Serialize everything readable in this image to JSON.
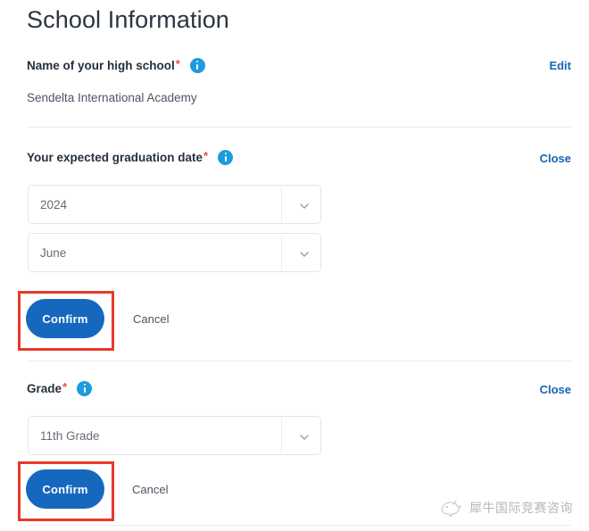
{
  "page": {
    "title": "School Information"
  },
  "sections": {
    "school_name": {
      "label": "Name of your high school",
      "required_marker": "*",
      "info_icon": "info-circle-icon",
      "action_label": "Edit",
      "value": "Sendelta International Academy"
    },
    "graduation_date": {
      "label": "Your expected graduation date",
      "required_marker": "*",
      "info_icon": "info-circle-icon",
      "action_label": "Close",
      "year_value": "2024",
      "month_value": "June",
      "chevron_icon": "chevron-down-icon",
      "confirm_label": "Confirm",
      "cancel_label": "Cancel"
    },
    "grade": {
      "label": "Grade",
      "required_marker": "*",
      "info_icon": "info-circle-icon",
      "action_label": "Close",
      "grade_value": "11th Grade",
      "chevron_icon": "chevron-down-icon",
      "confirm_label": "Confirm",
      "cancel_label": "Cancel"
    }
  },
  "watermark": {
    "logo_icon": "rhino-logo-icon",
    "text": "犀牛国际竞赛咨询"
  },
  "colors": {
    "primary_blue": "#1668bf",
    "link_blue": "#1765b5",
    "info_blue": "#1e9bdd",
    "required_red": "#e8503a",
    "annotation_red": "#e8392b",
    "divider_gray": "#e9ebee",
    "text_dark": "#25303b",
    "text_muted": "#656d78"
  }
}
